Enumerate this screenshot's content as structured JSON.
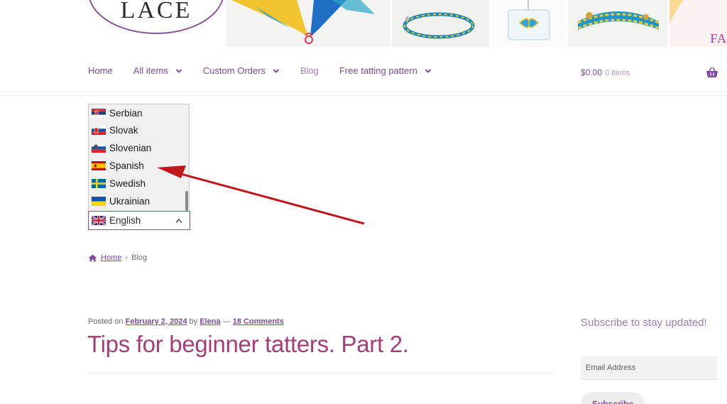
{
  "header": {
    "logo_text": "LACE",
    "banner_text": "FA"
  },
  "nav": {
    "items": [
      {
        "label": "Home"
      },
      {
        "label": "All items"
      },
      {
        "label": "Custom Orders"
      },
      {
        "label": "Blog"
      },
      {
        "label": "Free tatting pattern"
      }
    ],
    "cart_total": "$0.00",
    "cart_items": "0 items"
  },
  "language": {
    "options": [
      "Serbian",
      "Slovak",
      "Slovenian",
      "Spanish",
      "Swedish",
      "Ukrainian"
    ],
    "selected": "English"
  },
  "breadcrumb": {
    "home": "Home",
    "current": "Blog"
  },
  "post": {
    "posted_on": "Posted on",
    "date": "February 2, 2024",
    "by": "by",
    "author": "Elena",
    "dash": "—",
    "comments": "18 Comments",
    "title": "Tips for beginner tatters. Part 2."
  },
  "sidebar": {
    "subscribe_heading": "Subscribe to stay updated!",
    "email_placeholder": "Email Address",
    "subscribe_button": "Subscribe"
  },
  "colors": {
    "accent": "#7c4a9e",
    "title": "#a53d76",
    "annotation_arrow": "#c0171c"
  }
}
